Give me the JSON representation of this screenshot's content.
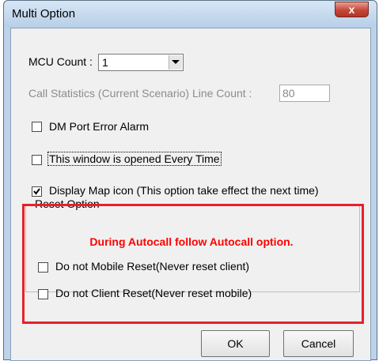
{
  "window": {
    "title": "Multi Option",
    "close_label": "x"
  },
  "mcu_count": {
    "label": "MCU Count :",
    "value": "1"
  },
  "call_statistics": {
    "label": "Call Statistics (Current Scenario) Line Count :",
    "value": "80"
  },
  "options": {
    "dm_port_error_alarm": {
      "label": "DM Port Error Alarm",
      "checked": false
    },
    "opened_every_time": {
      "label": "This window is opened Every Time",
      "checked": false
    },
    "display_map_icon": {
      "label": "Display Map icon (This option take effect the next time)",
      "checked": true
    }
  },
  "reset_option": {
    "title": "Reset Option",
    "notice": "During Autocall follow Autocall option.",
    "no_mobile_reset": {
      "label": "Do not Mobile Reset(Never reset client)",
      "checked": false
    },
    "no_client_reset": {
      "label": "Do not Client Reset(Never reset mobile)",
      "checked": false
    }
  },
  "buttons": {
    "ok": "OK",
    "cancel": "Cancel"
  },
  "colors": {
    "highlight": "#e8202a",
    "notice_text": "#ff0000",
    "title_bar": "#bcd3ea"
  }
}
